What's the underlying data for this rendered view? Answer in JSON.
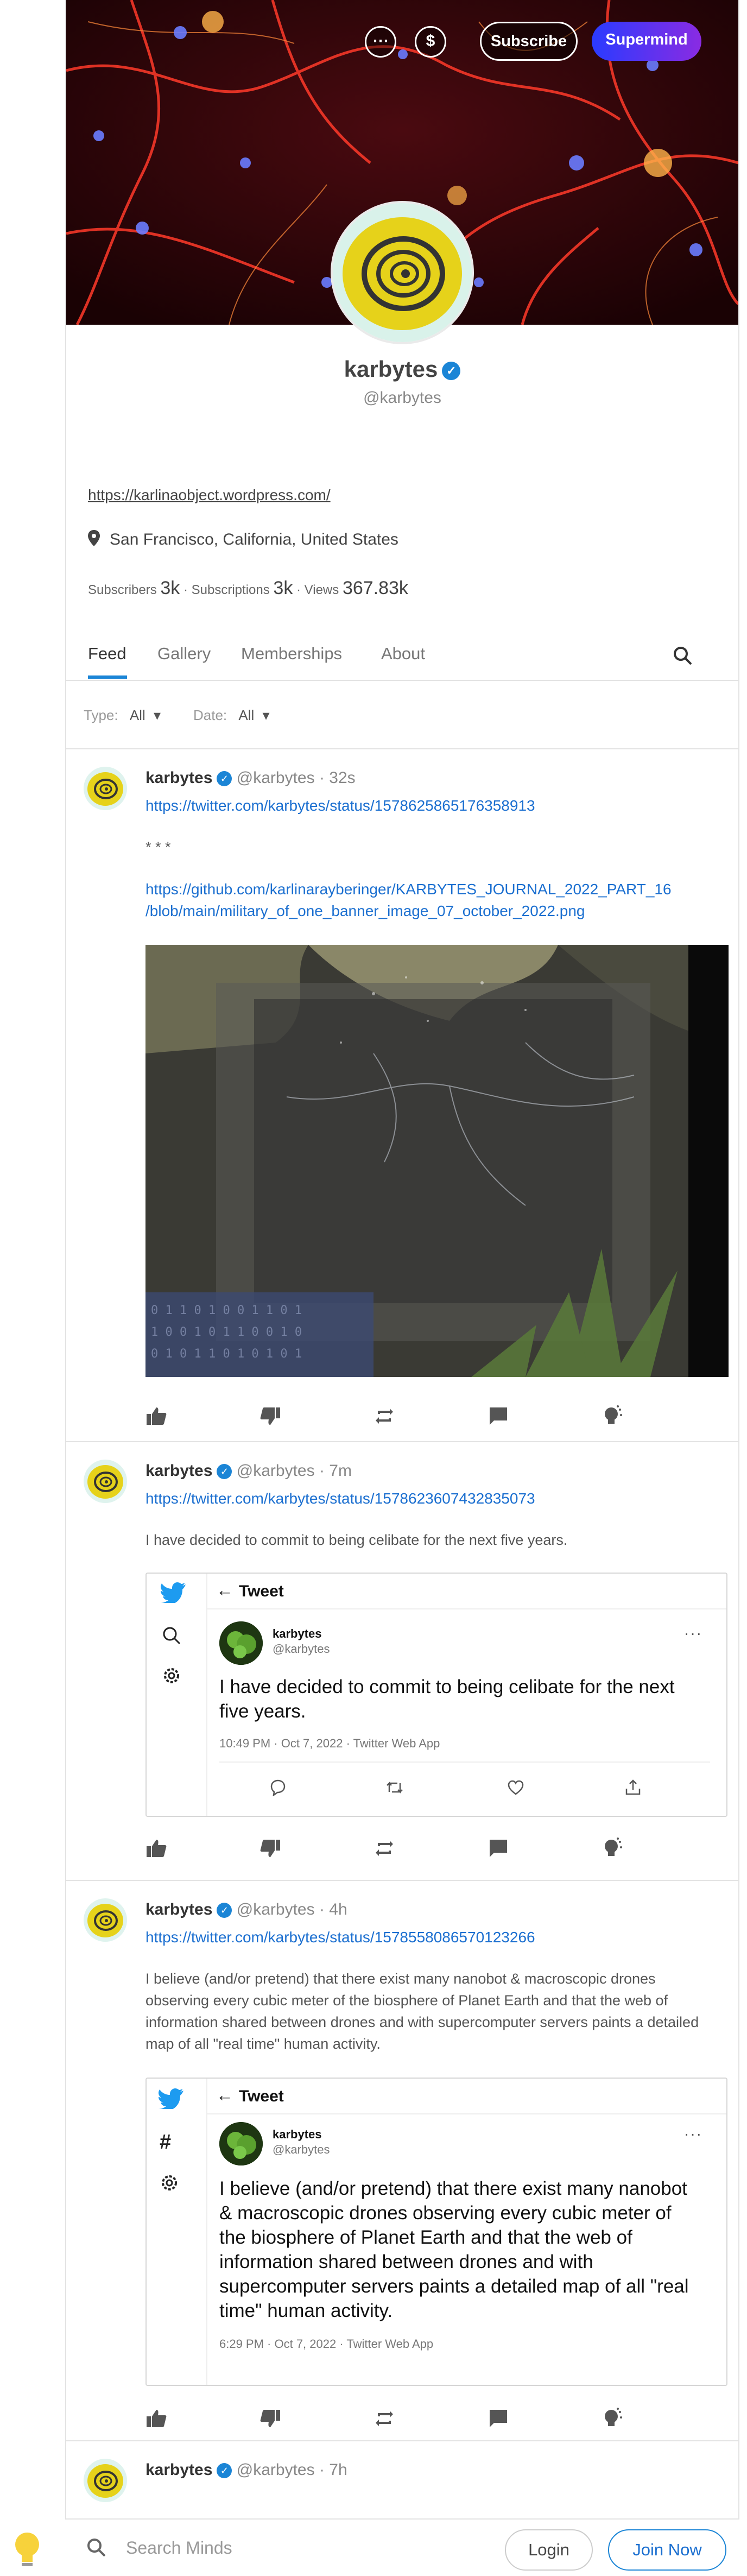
{
  "header": {
    "more_label": "⋯",
    "tip_label": "$",
    "subscribe_label": "Subscribe",
    "supermind_label": "Supermind"
  },
  "profile": {
    "name": "karbytes",
    "handle": "@karbytes",
    "website": "https://karlinaobject.wordpress.com/",
    "location": "San Francisco, California, United States",
    "subscribers_label": "Subscribers",
    "subscribers": "3k",
    "subscriptions_label": "Subscriptions",
    "subscriptions": "3k",
    "views_label": "Views",
    "views": "367.83k",
    "sep": "·"
  },
  "tabs": [
    "Feed",
    "Gallery",
    "Memberships",
    "About"
  ],
  "filters": {
    "type_label": "Type:",
    "type_value": "All",
    "date_label": "Date:",
    "date_value": "All"
  },
  "posts": [
    {
      "username": "karbytes",
      "handle": "@karbytes",
      "time": "32s",
      "link": "https://twitter.com/karbytes/status/1578625865176358913",
      "body": "* * *",
      "link2_line1": "https://github.com/karlinarayberinger/KARBYTES_JOURNAL_2022_PART_16",
      "link2_line2": "/blob/main/military_of_one_banner_image_07_october_2022.png"
    },
    {
      "username": "karbytes",
      "handle": "@karbytes",
      "time": "7m",
      "link": "https://twitter.com/karbytes/status/1578623607432835073",
      "body": "I have decided to commit to being celibate for the next five years.",
      "tweet": {
        "title": "Tweet",
        "name": "karbytes",
        "handle": "@karbytes",
        "text": "I have decided to commit to being celibate for the next five years.",
        "date": "10:49 PM · Oct 7, 2022 · Twitter Web App"
      }
    },
    {
      "username": "karbytes",
      "handle": "@karbytes",
      "time": "4h",
      "link": "https://twitter.com/karbytes/status/1578558086570123266",
      "body": "I believe (and/or pretend) that there exist many nanobot & macroscopic drones observing every cubic meter of the biosphere of Planet Earth and that the web of information shared between drones and with supercomputer servers paints a detailed map of all \"real time\" human activity.",
      "tweet": {
        "title": "Tweet",
        "name": "karbytes",
        "handle": "@karbytes",
        "text": "I believe (and/or pretend) that there exist many nanobot & macroscopic drones observing every cubic meter of the biosphere of Planet Earth and that the web of information shared between drones and with supercomputer servers paints a detailed map of all \"real time\" human activity.",
        "date": "6:29 PM · Oct 7, 2022 · Twitter Web App"
      }
    },
    {
      "username": "karbytes",
      "handle": "@karbytes",
      "time": "7h"
    }
  ],
  "bottom": {
    "search_placeholder": "Search Minds",
    "login_label": "Login",
    "join_label": "Join Now"
  },
  "colors": {
    "accent": "#1b85d6",
    "link": "#1b6fd0",
    "supermind_start": "#2a3bff",
    "supermind_end": "#8a2be2"
  },
  "dot": " · ",
  "caret": "▾"
}
